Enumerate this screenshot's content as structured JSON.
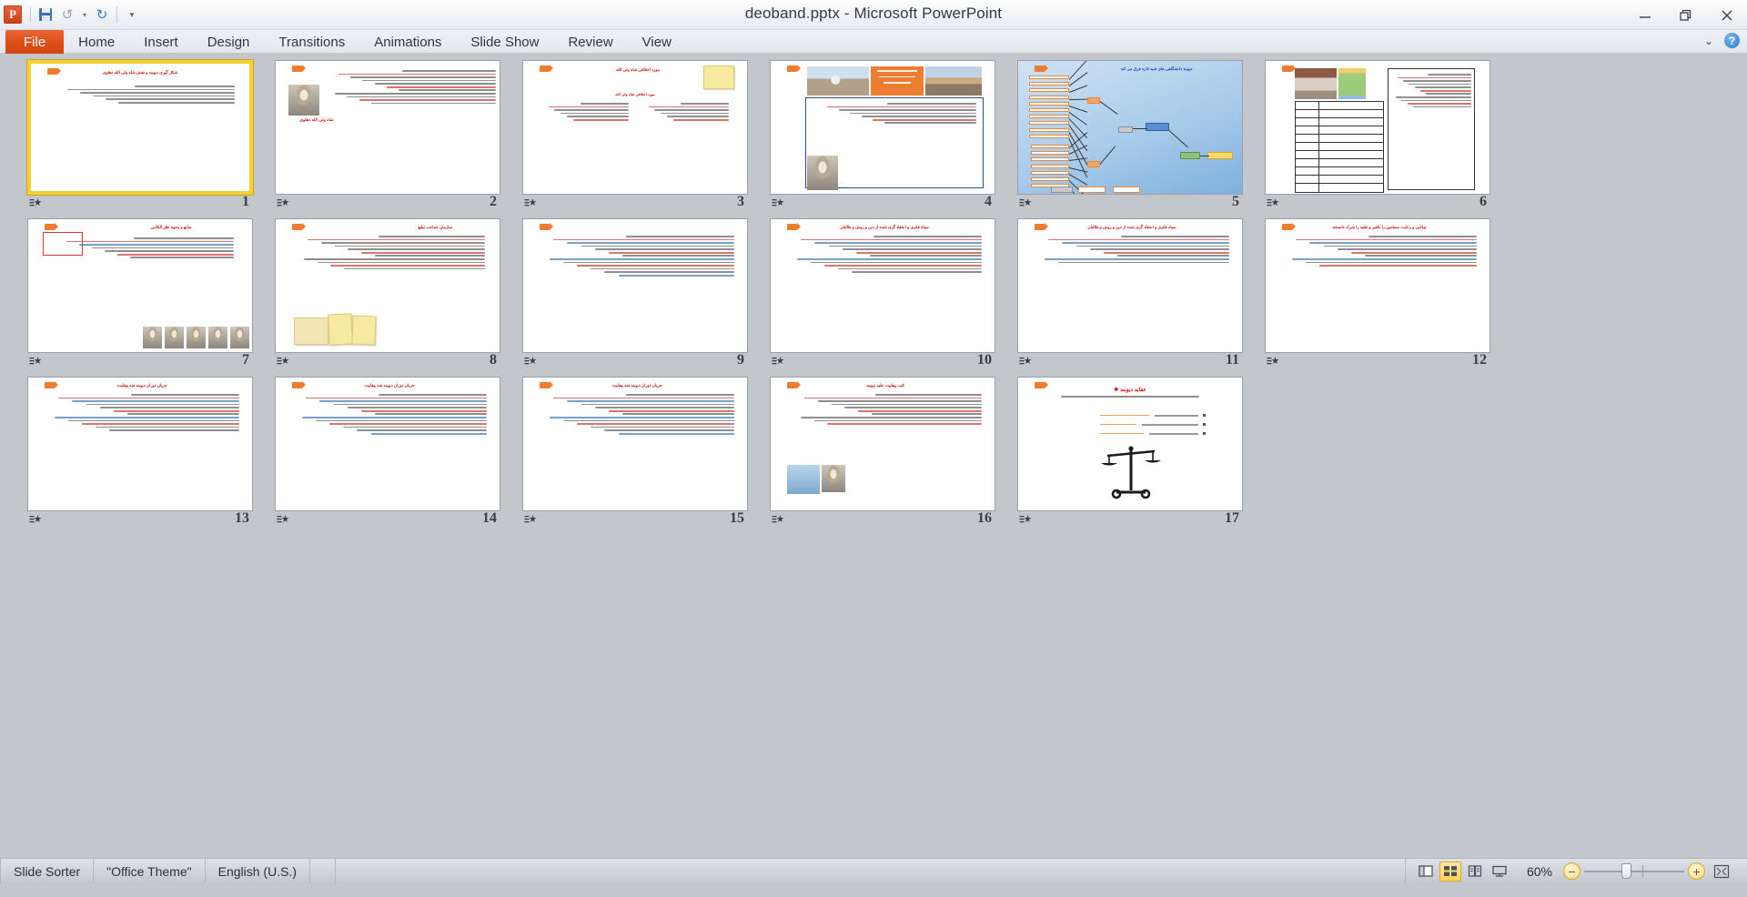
{
  "window": {
    "title": "deoband.pptx  -  Microsoft PowerPoint",
    "app_logo": "powerpoint-logo",
    "minimize_label": "—",
    "restore_label": "restore-icon",
    "close_label": "✕"
  },
  "quick_access": {
    "items": [
      {
        "name": "save-icon",
        "label": "Save"
      },
      {
        "name": "undo-icon",
        "label": "Undo"
      },
      {
        "name": "undo-dropdown-icon",
        "label": "▾"
      },
      {
        "name": "redo-icon",
        "label": "Redo"
      },
      {
        "name": "customize-qat-icon",
        "label": "▾"
      }
    ]
  },
  "ribbon": {
    "tabs": [
      {
        "id": "file",
        "label": "File"
      },
      {
        "id": "home",
        "label": "Home"
      },
      {
        "id": "insert",
        "label": "Insert"
      },
      {
        "id": "design",
        "label": "Design"
      },
      {
        "id": "transitions",
        "label": "Transitions"
      },
      {
        "id": "animations",
        "label": "Animations"
      },
      {
        "id": "slideshow",
        "label": "Slide Show"
      },
      {
        "id": "review",
        "label": "Review"
      },
      {
        "id": "view",
        "label": "View"
      }
    ],
    "active_tab": "file",
    "collapse_icon": "chevron-up-icon",
    "help_icon": "help-icon",
    "help_label": "?"
  },
  "colors": {
    "accent_orange": "#de4f18",
    "selection_yellow": "#f5d033",
    "title_red": "#d9480f",
    "workspace_gray": "#c3c7cc",
    "node_orange": "#ed7d31",
    "diagram_blue": "#5b8fd4"
  },
  "slide_sorter": {
    "selected_slide": 1,
    "total_slides": 17,
    "slides": [
      {
        "number": "1",
        "title": "شکل گیری دیوبند و نقش شاه ولی الله دهلوی",
        "title_color": "red",
        "layout": "title-lines",
        "lines": 6
      },
      {
        "number": "2",
        "title": "شاه ولی الله دهلوی",
        "title_color": "red",
        "layout": "photo-left-text",
        "lines": 11
      },
      {
        "number": "3",
        "title": "مورد اختلافی شاه ولی الله",
        "title_color": "red",
        "layout": "two-column-list",
        "lines": 7
      },
      {
        "number": "4",
        "title": "",
        "title_color": "red",
        "layout": "images-top-text",
        "lines": 7
      },
      {
        "number": "5",
        "title": "دیوبند دانشگاهی های شبه قاره فرق می کند",
        "title_color": "blue",
        "layout": "org-chart",
        "lines": 0
      },
      {
        "number": "6",
        "title": "",
        "title_color": "red",
        "layout": "table-and-images",
        "lines": 11
      },
      {
        "number": "7",
        "title": "منابع و وجوه نظر الکتابی",
        "title_color": "red",
        "layout": "text-with-faces",
        "lines": 7
      },
      {
        "number": "8",
        "title": "سازمان جماعت تبلیغ",
        "title_color": "red",
        "layout": "text-sticky",
        "lines": 11
      },
      {
        "number": "9",
        "title": "",
        "title_color": "red",
        "layout": "plain-text",
        "lines": 13
      },
      {
        "number": "10",
        "title": "سیاه فکری و اعتقاد گری شده از دین و روش و طالبان",
        "title_color": "red",
        "layout": "plain-text",
        "lines": 12
      },
      {
        "number": "11",
        "title": "سیاه فکری و اعتقاد گری شده از دین و روش و طالبان",
        "title_color": "red",
        "layout": "plain-text",
        "lines": 9
      },
      {
        "number": "12",
        "title": "توانایی و رعایت مسلمین را تکفیر و تقلید را شرک دانستند",
        "title_color": "red",
        "layout": "plain-text",
        "lines": 10
      },
      {
        "number": "13",
        "title": "جریان دوران دیوبند ضد وهابیت",
        "title_color": "red",
        "layout": "plain-text",
        "lines": 12
      },
      {
        "number": "14",
        "title": "جریان دوران دیوبند ضد وهابیت",
        "title_color": "red",
        "layout": "plain-text",
        "lines": 13
      },
      {
        "number": "15",
        "title": "جریان دوران دیوبند ضد وهابیت",
        "title_color": "red",
        "layout": "plain-text",
        "lines": 13
      },
      {
        "number": "16",
        "title": "کتب وهابیت علیه دیوبند",
        "title_color": "red",
        "layout": "text-image-left",
        "lines": 10
      },
      {
        "number": "17",
        "title": "❖ عقاید دیوبند",
        "title_color": "red",
        "layout": "scales",
        "lines": 3
      }
    ]
  },
  "status_bar": {
    "view_name": "Slide Sorter",
    "theme_name": "\"Office Theme\"",
    "language": "English (U.S.)",
    "zoom_level": "60%",
    "view_buttons": [
      {
        "name": "normal-view-button",
        "label": "Normal",
        "active": false
      },
      {
        "name": "slide-sorter-view-button",
        "label": "Slide Sorter",
        "active": true
      },
      {
        "name": "reading-view-button",
        "label": "Reading View",
        "active": false
      },
      {
        "name": "slide-show-button",
        "label": "Slide Show",
        "active": false
      }
    ],
    "zoom_out_label": "−",
    "zoom_in_label": "+",
    "fit_button_label": "Fit slide to current window"
  }
}
